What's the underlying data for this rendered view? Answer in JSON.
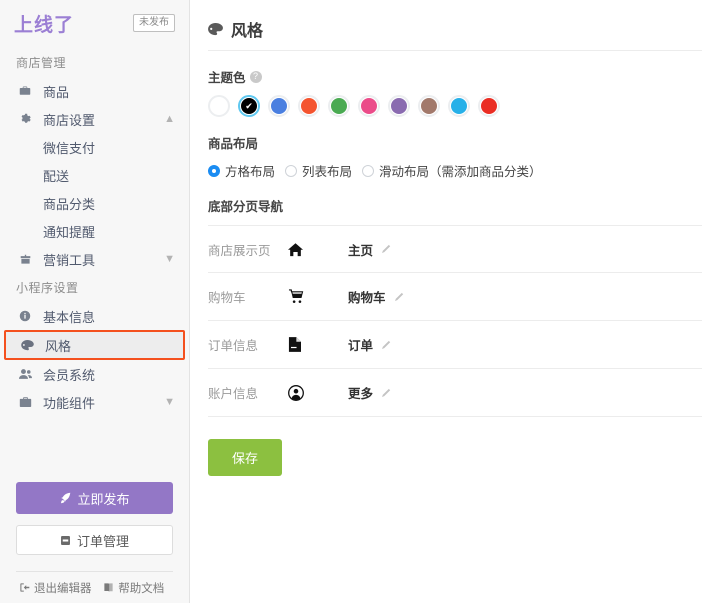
{
  "sidebar": {
    "logo": "上线了",
    "status_badge": "未发布",
    "groups": [
      {
        "title": "商店管理",
        "items": [
          {
            "label": "商品",
            "icon": "briefcase-icon",
            "sub": false,
            "chevron": "",
            "active": false
          },
          {
            "label": "商店设置",
            "icon": "gear-icon",
            "sub": false,
            "chevron": "▲",
            "active": false
          },
          {
            "label": "微信支付",
            "icon": "",
            "sub": true,
            "chevron": "",
            "active": false
          },
          {
            "label": "配送",
            "icon": "",
            "sub": true,
            "chevron": "",
            "active": false
          },
          {
            "label": "商品分类",
            "icon": "",
            "sub": true,
            "chevron": "",
            "active": false
          },
          {
            "label": "通知提醒",
            "icon": "",
            "sub": true,
            "chevron": "",
            "active": false
          },
          {
            "label": "营销工具",
            "icon": "gift-icon",
            "sub": false,
            "chevron": "▼",
            "active": false
          }
        ]
      },
      {
        "title": "小程序设置",
        "items": [
          {
            "label": "基本信息",
            "icon": "info-icon",
            "sub": false,
            "chevron": "",
            "active": false
          },
          {
            "label": "风格",
            "icon": "palette-icon",
            "sub": false,
            "chevron": "",
            "active": true
          },
          {
            "label": "会员系统",
            "icon": "users-icon",
            "sub": false,
            "chevron": "",
            "active": false
          },
          {
            "label": "功能组件",
            "icon": "toolbox-icon",
            "sub": false,
            "chevron": "▼",
            "active": false
          }
        ]
      }
    ],
    "publish_button": "立即发布",
    "publish_icon": "rocket-icon",
    "orders_button": "订单管理",
    "orders_icon": "clipboard-icon",
    "footer_links": [
      {
        "label": "退出编辑器",
        "icon": "exit-icon"
      },
      {
        "label": "帮助文档",
        "icon": "book-icon"
      }
    ],
    "active_border_color": "#f4501e",
    "brand_color": "#9b7fd4"
  },
  "main": {
    "page_title": "风格",
    "page_icon": "palette-icon",
    "theme_color": {
      "label": "主题色",
      "help_icon": "question-icon",
      "selected_index": 1,
      "swatches": [
        {
          "name": "white",
          "hex": "#ffffff"
        },
        {
          "name": "black",
          "hex": "#000000"
        },
        {
          "name": "blue",
          "hex": "#4a7fe0"
        },
        {
          "name": "orange",
          "hex": "#f4542f"
        },
        {
          "name": "green",
          "hex": "#4aaa52"
        },
        {
          "name": "pink",
          "hex": "#eb4c89"
        },
        {
          "name": "purple",
          "hex": "#8a6bb0"
        },
        {
          "name": "brown",
          "hex": "#a2796b"
        },
        {
          "name": "cyan",
          "hex": "#27b0e8"
        },
        {
          "name": "red",
          "hex": "#ea2d23"
        }
      ]
    },
    "product_layout": {
      "label": "商品布局",
      "selected_index": 0,
      "options": [
        "方格布局",
        "列表布局",
        "滑动布局（需添加商品分类）"
      ]
    },
    "bottom_nav": {
      "label": "底部分页导航",
      "rows": [
        {
          "name": "商店展示页",
          "icon": "home-icon",
          "text": "主页",
          "edit_icon": "pencil-icon"
        },
        {
          "name": "购物车",
          "icon": "cart-icon",
          "text": "购物车",
          "edit_icon": "pencil-icon"
        },
        {
          "name": "订单信息",
          "icon": "doc-icon",
          "text": "订单",
          "edit_icon": "pencil-icon"
        },
        {
          "name": "账户信息",
          "icon": "avatar-icon",
          "text": "更多",
          "edit_icon": "pencil-icon"
        }
      ]
    },
    "save_button": "保存",
    "save_color": "#8cc040"
  }
}
